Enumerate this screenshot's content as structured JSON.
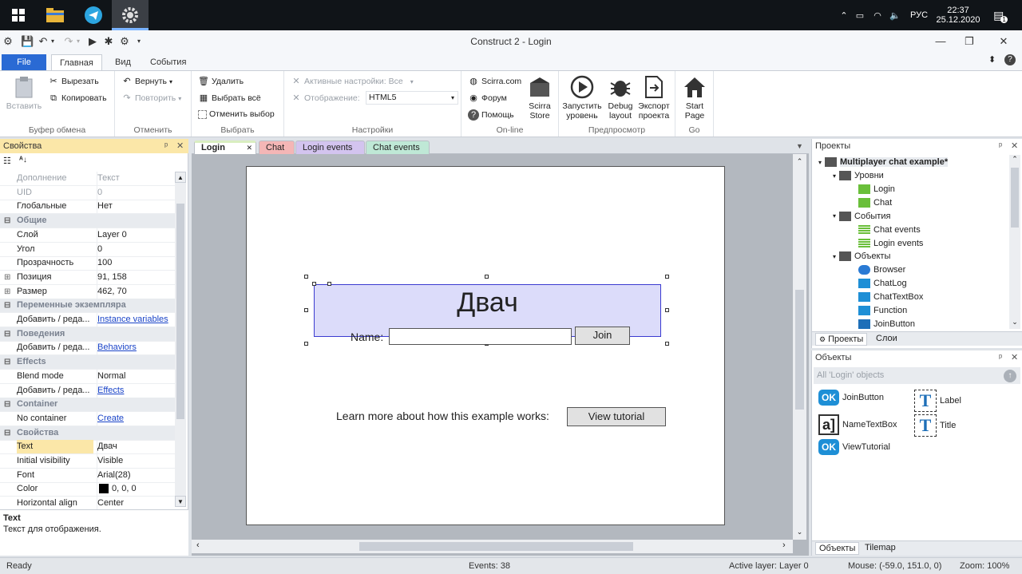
{
  "taskbar": {
    "tray": {
      "lang": "РУС",
      "time": "22:37",
      "date": "25.12.2020",
      "notif_count": "1"
    }
  },
  "window": {
    "title": "Construct 2 - Login"
  },
  "ribbon_tabs": [
    "File",
    "Главная",
    "Вид",
    "События"
  ],
  "ribbon": {
    "clipboard": {
      "paste": "Вставить",
      "cut": "Вырезать",
      "copy": "Копировать",
      "label": "Буфер обмена"
    },
    "undo": {
      "redo": "Вернуть",
      "repeat": "Повторить",
      "label": "Отменить"
    },
    "select": {
      "delete": "Удалить",
      "select_all": "Выбрать всё",
      "deselect": "Отменить выбор",
      "label": "Выбрать"
    },
    "settings": {
      "active_settings": "Активные настройки: Все",
      "display_label": "Отображение:",
      "display_value": "HTML5",
      "label": "Настройки"
    },
    "online": {
      "scirra": "Scirra.com",
      "forum": "Форум",
      "help": "Помощь",
      "store_1": "Scirra",
      "store_2": "Store",
      "label": "On-line"
    },
    "preview": {
      "run_1": "Запустить",
      "run_2": "уровень",
      "debug_1": "Debug",
      "debug_2": "layout",
      "export_1": "Экспорт",
      "export_2": "проекта",
      "label": "Предпросмотр"
    },
    "go": {
      "start_1": "Start",
      "start_2": "Page",
      "label": "Go"
    }
  },
  "properties": {
    "title": "Свойства",
    "rows": [
      {
        "k": "Дополнение",
        "v": "Текст",
        "muted": true
      },
      {
        "k": "UID",
        "v": "0",
        "muted": true
      },
      {
        "k": "Глобальные",
        "v": "Нет"
      },
      {
        "cat": "Общие"
      },
      {
        "k": "Слой",
        "v": "Layer 0"
      },
      {
        "k": "Угол",
        "v": "0"
      },
      {
        "k": "Прозрачность",
        "v": "100"
      },
      {
        "k": "Позиция",
        "v": "91, 158",
        "exp": true
      },
      {
        "k": "Размер",
        "v": "462, 70",
        "exp": true
      },
      {
        "cat": "Переменные экземпляра"
      },
      {
        "k": "Добавить / реда...",
        "v": "Instance variables",
        "link": true
      },
      {
        "cat": "Поведения"
      },
      {
        "k": "Добавить / реда...",
        "v": "Behaviors",
        "link": true
      },
      {
        "cat": "Effects"
      },
      {
        "k": "Blend mode",
        "v": "Normal"
      },
      {
        "k": "Добавить / реда...",
        "v": "Effects",
        "link": true
      },
      {
        "cat": "Container"
      },
      {
        "k": "No container",
        "v": "Create",
        "link": true
      },
      {
        "cat": "Свойства"
      },
      {
        "k": "Text",
        "v": "Двач",
        "sel": true
      },
      {
        "k": "Initial visibility",
        "v": "Visible"
      },
      {
        "k": "Font",
        "v": "Arial(28)"
      },
      {
        "k": "Color",
        "v": "0, 0, 0",
        "swatch": "#000000"
      },
      {
        "k": "Horizontal align",
        "v": "Center"
      }
    ],
    "help_title": "Text",
    "help_text": "Текст для отображения."
  },
  "layout_tabs": [
    {
      "label": "Login",
      "color": "#d9eec0",
      "active": true
    },
    {
      "label": "Chat",
      "color": "#f4b6b6"
    },
    {
      "label": "Login events",
      "color": "#d3c4ef"
    },
    {
      "label": "Chat events",
      "color": "#bfe8d6"
    }
  ],
  "canvas": {
    "title": "Двач",
    "name_label": "Name:",
    "join_label": "Join",
    "learn_text": "Learn more about how this example works:",
    "tutorial_label": "View tutorial"
  },
  "projects": {
    "title": "Проекты",
    "root": "Multiplayer chat example*",
    "tree": [
      {
        "label": "Уровни",
        "level": 1,
        "folder": true
      },
      {
        "label": "Login",
        "level": 2,
        "type": "layout"
      },
      {
        "label": "Chat",
        "level": 2,
        "type": "layout"
      },
      {
        "label": "События",
        "level": 1,
        "folder": true
      },
      {
        "label": "Chat events",
        "level": 2,
        "type": "events"
      },
      {
        "label": "Login events",
        "level": 2,
        "type": "events"
      },
      {
        "label": "Объекты",
        "level": 1,
        "folder": true
      },
      {
        "label": "Browser",
        "level": 2,
        "type": "browser"
      },
      {
        "label": "ChatLog",
        "level": 2,
        "type": "textbox"
      },
      {
        "label": "ChatTextBox",
        "level": 2,
        "type": "textbox"
      },
      {
        "label": "Function",
        "level": 2,
        "type": "function"
      },
      {
        "label": "JoinButton",
        "level": 2,
        "type": "button"
      }
    ],
    "bottom_tabs": [
      "Проекты",
      "Слои"
    ]
  },
  "objects": {
    "title": "Объекты",
    "filter": "All 'Login' objects",
    "items": [
      {
        "label": "JoinButton",
        "type": "button"
      },
      {
        "label": "Label",
        "type": "text"
      },
      {
        "label": "NameTextBox",
        "type": "textbox"
      },
      {
        "label": "Title",
        "type": "text"
      },
      {
        "label": "ViewTutorial",
        "type": "button"
      }
    ],
    "bottom_tabs": [
      "Объекты",
      "Tilemap"
    ]
  },
  "status": {
    "ready": "Ready",
    "events": "Events: 38",
    "active_layer": "Active layer: Layer 0",
    "mouse": "Mouse: (-59.0, 151.0, 0)",
    "zoom": "Zoom: 100%"
  }
}
